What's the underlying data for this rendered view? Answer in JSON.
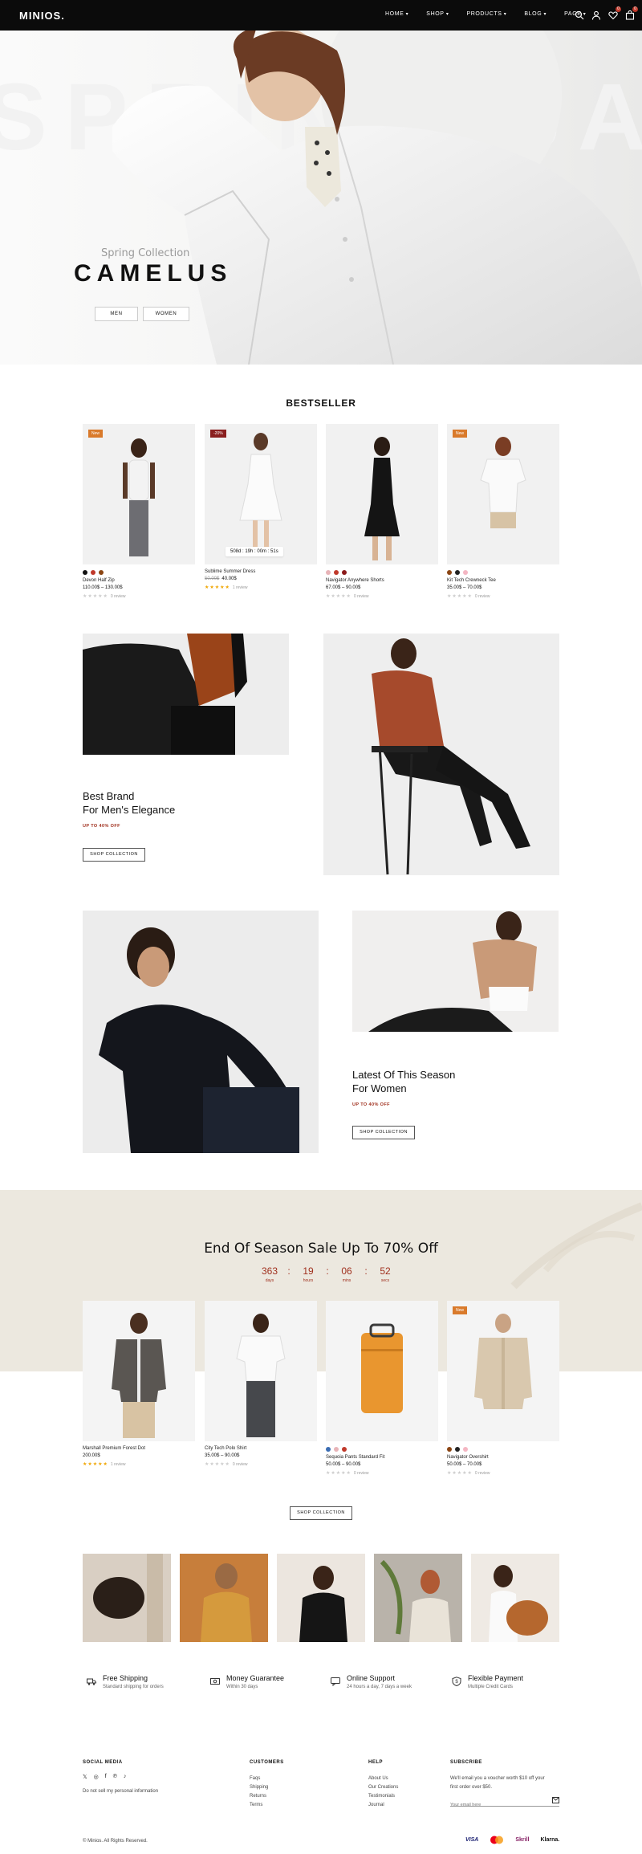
{
  "header": {
    "logo": "MINIOS.",
    "nav": [
      "HOME",
      "SHOP",
      "PRODUCTS",
      "BLOG",
      "PAGE"
    ],
    "cart_count": "0",
    "wishlist_count": "0",
    "icons": [
      "search-icon",
      "user-icon",
      "heart-icon",
      "cart-icon"
    ]
  },
  "hero": {
    "subtitle": "Spring Collection",
    "title": "CAMELUS",
    "btn_men": "MEN",
    "btn_women": "WOMEN",
    "watermark": "SPRING SALE"
  },
  "bestseller": {
    "title": "BESTSELLER",
    "products": [
      {
        "tag": "New",
        "name": "Devon Half Zip",
        "price": "110.00$ – 130.00$",
        "old_price": "",
        "reviews": "0 review",
        "swatches": [
          "#111111",
          "#c0392b",
          "#8b4513"
        ]
      },
      {
        "tag": "-20%",
        "name": "Sublime Summer Dress",
        "price": "40.00$",
        "old_price": "50.00$",
        "reviews": "1 review",
        "timer": "508d : 19h : 00m : 51s"
      },
      {
        "tag": "",
        "name": "Navigator Anywhere Shorts",
        "price": "67.00$ – 90.00$",
        "old_price": "",
        "reviews": "0 review",
        "swatches": [
          "#e8b4b8",
          "#c0392b",
          "#8b1a1a"
        ]
      },
      {
        "tag": "New",
        "name": "Kit Tech Crewneck Tee",
        "price": "35.00$ – 70.00$",
        "old_price": "",
        "reviews": "0 review",
        "swatches": [
          "#8b4513",
          "#222222",
          "#f4b6c2"
        ]
      }
    ]
  },
  "banner_men": {
    "title_line1": "Best Brand",
    "title_line2": "For Men's Elegance",
    "offer": "UP TO 40% OFF",
    "button": "SHOP COLLECTION"
  },
  "banner_women": {
    "title_line1": "Latest Of This Season",
    "title_line2": "For Women",
    "offer": "UP TO 40% OFF",
    "button": "SHOP COLLECTION"
  },
  "sale": {
    "title": "End Of Season Sale Up To 70% Off",
    "countdown": [
      {
        "value": "363",
        "label": "days"
      },
      {
        "value": "19",
        "label": "hours"
      },
      {
        "value": "06",
        "label": "mins"
      },
      {
        "value": "52",
        "label": "secs"
      }
    ],
    "products": [
      {
        "tag": "",
        "name": "Marshall Premium Forest Dot",
        "price": "200.00$",
        "reviews": "1 review",
        "gold": true
      },
      {
        "tag": "",
        "name": "City Tech Polo Shirt",
        "price": "35.00$ – 90.00$",
        "reviews": "0 review",
        "gold": false
      },
      {
        "tag": "",
        "name": "Sequoia Pants Standard Fit",
        "price": "50.00$ – 90.00$",
        "reviews": "0 review",
        "gold": false,
        "swatches": [
          "#3b6db3",
          "#e8b4b8",
          "#c0392b"
        ]
      },
      {
        "tag": "New",
        "name": "Navigator Overshirt",
        "price": "50.00$ – 70.00$",
        "reviews": "0 review",
        "gold": false,
        "swatches": [
          "#8b4513",
          "#222222",
          "#f4b6c2"
        ]
      }
    ],
    "button": "SHOP COLLECTION"
  },
  "features": [
    {
      "title": "Free Shipping",
      "sub": "Standard shipping for orders",
      "icon": "truck-icon"
    },
    {
      "title": "Money Guarantee",
      "sub": "Within 30 days",
      "icon": "money-icon"
    },
    {
      "title": "Online Support",
      "sub": "24 hours a day, 7 days a week",
      "icon": "support-icon"
    },
    {
      "title": "Flexible Payment",
      "sub": "Multiple Credit Cards",
      "icon": "shield-icon"
    }
  ],
  "footer": {
    "social_heading": "SOCIAL MEDIA",
    "social_icons": [
      "x-icon",
      "instagram-icon",
      "facebook-icon",
      "pinterest-icon",
      "tiktok-icon"
    ],
    "privacy": "Do not sell my personal information",
    "customers_heading": "CUSTOMERS",
    "customers": [
      "Faqs",
      "Shipping",
      "Returns",
      "Terms"
    ],
    "help_heading": "HELP",
    "help": [
      "About Us",
      "Our Creations",
      "Testimonials",
      "Journal"
    ],
    "subscribe_heading": "SUBSCRIBE",
    "subscribe_text_1": "We'll email you a voucher worth $10 off your",
    "subscribe_text_2": "first order over $50.",
    "email_placeholder": "Your email here",
    "copyright": "© Minios. All Rights Reserved.",
    "payments": [
      "VISA",
      "Mastercard",
      "Skrill",
      "Klarna."
    ]
  },
  "colors": {
    "accent": "#a0301e",
    "sale_bg": "#ece8df",
    "new_tag": "#d97a2b"
  }
}
